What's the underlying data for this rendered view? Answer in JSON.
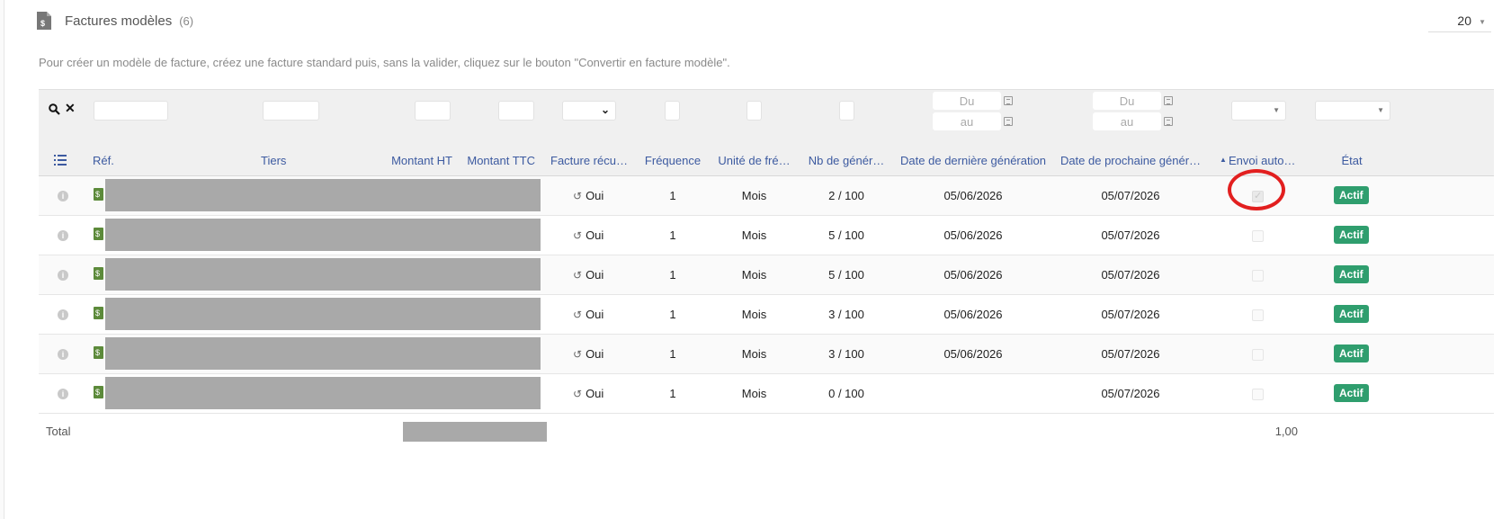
{
  "header": {
    "title": "Factures modèles",
    "count": "(6)",
    "page_size": "20"
  },
  "hint": "Pour créer un modèle de facture, créez une facture standard puis, sans la valider, cliquez sur le bouton \"Convertir en facture modèle\".",
  "filters": {
    "date_from_placeholder": "Du",
    "date_to_placeholder": "au"
  },
  "columns": {
    "ref": "Réf.",
    "tiers": "Tiers",
    "montant_ht": "Montant HT",
    "montant_ttc": "Montant TTC",
    "facture_recurrente": "Facture récu…",
    "frequence": "Fréquence",
    "unite": "Unité de fré…",
    "nb_generation": "Nb de génér…",
    "date_derniere": "Date de dernière génération",
    "date_prochaine": "Date de prochaine génér…",
    "envoi_auto": "Envoi auto…",
    "etat": "État"
  },
  "rows": [
    {
      "recurring": "Oui",
      "frequence": "1",
      "unite": "Mois",
      "nb": "2 / 100",
      "derniere": "05/06/2026",
      "prochaine": "05/07/2026",
      "envoi_checked": true,
      "etat": "Actif"
    },
    {
      "recurring": "Oui",
      "frequence": "1",
      "unite": "Mois",
      "nb": "5 / 100",
      "derniere": "05/06/2026",
      "prochaine": "05/07/2026",
      "envoi_checked": false,
      "etat": "Actif"
    },
    {
      "recurring": "Oui",
      "frequence": "1",
      "unite": "Mois",
      "nb": "5 / 100",
      "derniere": "05/06/2026",
      "prochaine": "05/07/2026",
      "envoi_checked": false,
      "etat": "Actif"
    },
    {
      "recurring": "Oui",
      "frequence": "1",
      "unite": "Mois",
      "nb": "3 / 100",
      "derniere": "05/06/2026",
      "prochaine": "05/07/2026",
      "envoi_checked": false,
      "etat": "Actif"
    },
    {
      "recurring": "Oui",
      "frequence": "1",
      "unite": "Mois",
      "nb": "3 / 100",
      "derniere": "05/06/2026",
      "prochaine": "05/07/2026",
      "envoi_checked": false,
      "etat": "Actif"
    },
    {
      "recurring": "Oui",
      "frequence": "1",
      "unite": "Mois",
      "nb": "0 / 100",
      "derniere": "",
      "prochaine": "05/07/2026",
      "envoi_checked": false,
      "etat": "Actif"
    }
  ],
  "total": {
    "label": "Total",
    "frequence_sum": "1,00"
  },
  "colors": {
    "header_link": "#3c5aa0",
    "badge_green": "#2f9e6e",
    "highlight_red": "#e21f1f"
  }
}
